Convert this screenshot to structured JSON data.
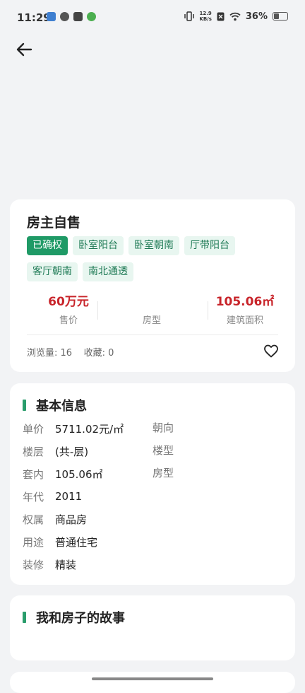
{
  "status_bar": {
    "time": "11:29",
    "net_speed_value": "12.9",
    "net_speed_unit": "KB/s",
    "battery_pct": "36%",
    "battery_level": 0.36
  },
  "listing": {
    "title": "房主自售",
    "tags": [
      "已确权",
      "卧室阳台",
      "卧室朝南",
      "厅带阳台",
      "客厅朝南",
      "南北通透"
    ],
    "stats": [
      {
        "value": "60万元",
        "label": "售价"
      },
      {
        "value": "",
        "label": "房型"
      },
      {
        "value": "105.06㎡",
        "label": "建筑面积"
      }
    ],
    "views_label": "浏览量:",
    "views": "16",
    "favorites_label": "收藏:",
    "favorites": "0"
  },
  "basic_info": {
    "title": "基本信息",
    "rows": [
      {
        "label": "单价",
        "value": "5711.02元/㎡"
      },
      {
        "label": "楼层",
        "value": "(共-层)"
      },
      {
        "label": "套内",
        "value": "105.06㎡"
      },
      {
        "label": "年代",
        "value": "2011"
      },
      {
        "label": "权属",
        "value": "商品房"
      },
      {
        "label": "用途",
        "value": "普通住宅"
      },
      {
        "label": "装修",
        "value": "精装"
      }
    ],
    "right_labels": [
      "朝向",
      "楼型",
      "房型"
    ]
  },
  "story": {
    "title": "我和房子的故事"
  },
  "colors": {
    "accent": "#2a9d6c",
    "price": "#c8242a",
    "background": "#f2f3f5"
  }
}
